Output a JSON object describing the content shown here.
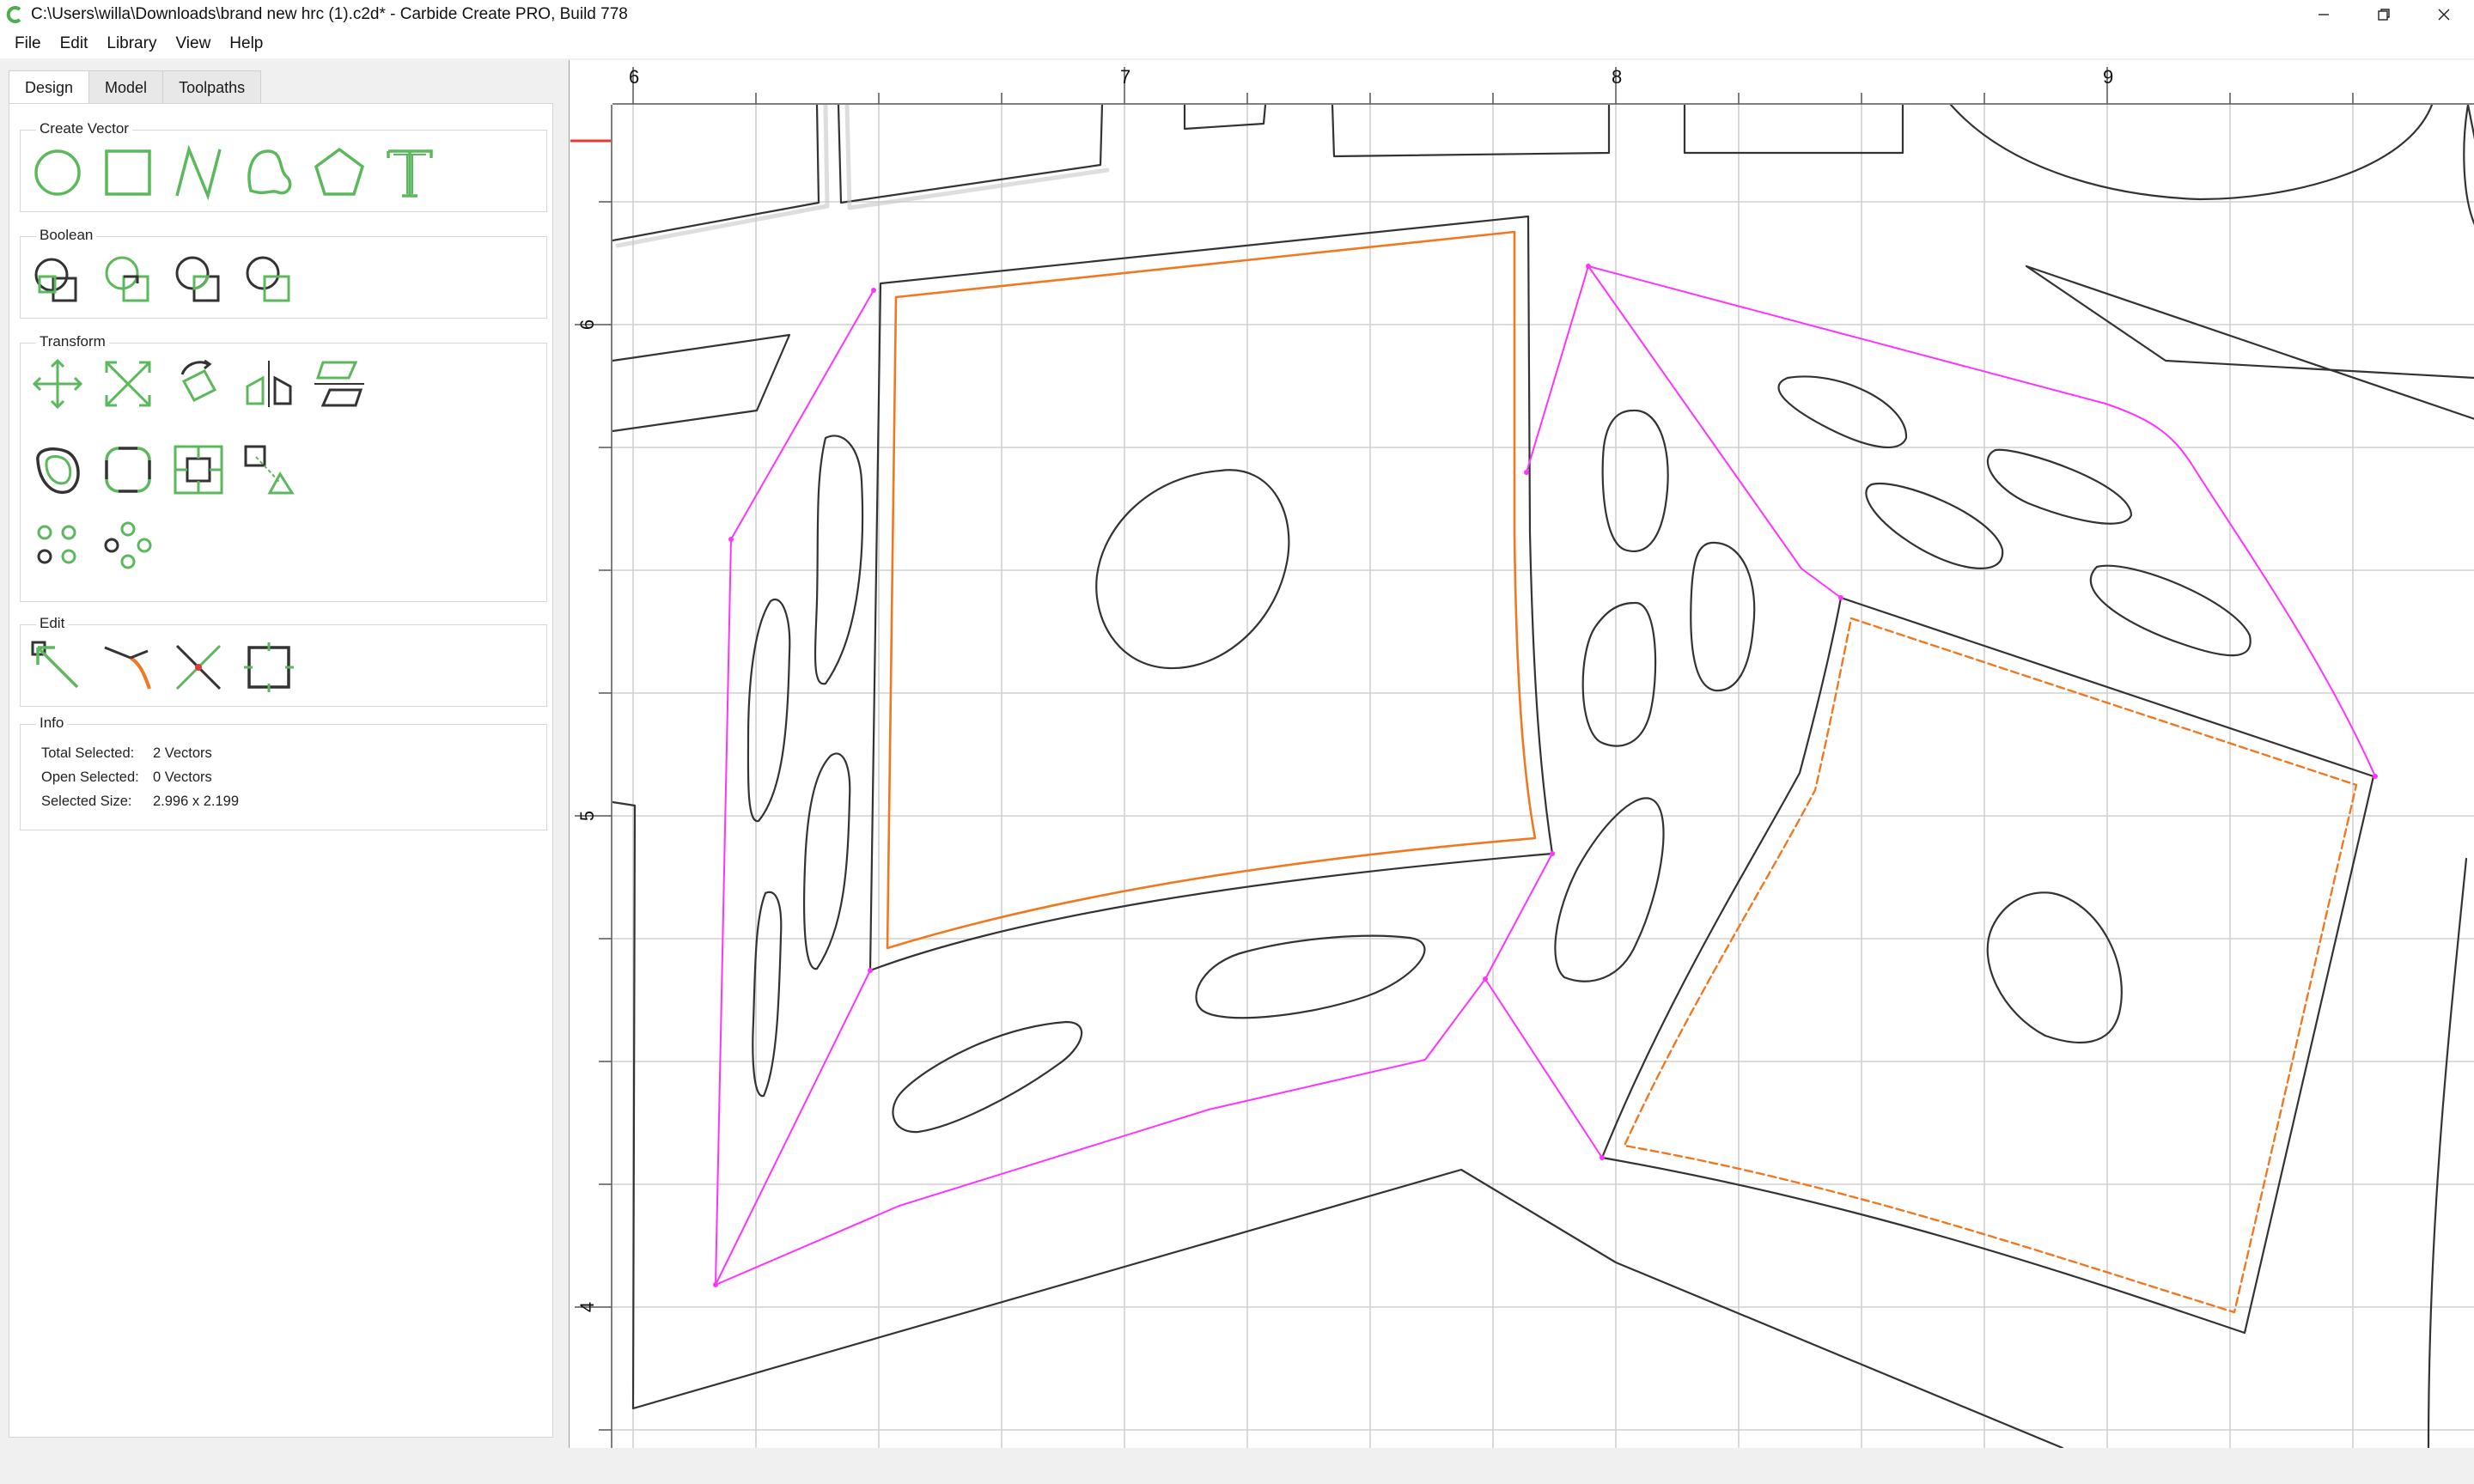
{
  "window": {
    "title": "C:\\Users\\willa\\Downloads\\brand new hrc (1).c2d* - Carbide Create PRO, Build 778",
    "controls": [
      "minimize-icon",
      "restore-icon",
      "close-icon"
    ]
  },
  "menu": [
    "File",
    "Edit",
    "Library",
    "View",
    "Help"
  ],
  "tabs": [
    "Design",
    "Model",
    "Toolpaths"
  ],
  "active_tab": "Design",
  "groups": {
    "create_vector": "Create Vector",
    "boolean": "Boolean",
    "transform": "Transform",
    "edit": "Edit",
    "info": "Info"
  },
  "tools": {
    "create_vector": [
      "circle-icon",
      "rectangle-icon",
      "polyline-icon",
      "curve-icon",
      "polygon-icon",
      "text-icon"
    ],
    "boolean": [
      "union-icon",
      "subtract-icon",
      "intersect-icon",
      "merge-icon"
    ],
    "transform": [
      "move-icon",
      "scale-icon",
      "rotate-icon",
      "mirror-icon",
      "align-icon",
      "offset-icon",
      "fillet-icon",
      "center-icon",
      "snap-icon",
      "linear-array-icon",
      "circular-array-icon"
    ],
    "edit": [
      "node-edit-icon",
      "trim-icon",
      "cut-icon",
      "bounding-box-icon"
    ]
  },
  "info": {
    "total_selected_label": "Total Selected:",
    "total_selected_value": "2 Vectors",
    "open_selected_label": "Open Selected:",
    "open_selected_value": "0 Vectors",
    "selected_size_label": "Selected Size:",
    "selected_size_value": "2.996 x 2.199"
  },
  "rulers": {
    "top_labels": [
      "6",
      "7",
      "8",
      "9"
    ],
    "left_labels": [
      "6",
      "5",
      "4"
    ]
  },
  "colors": {
    "accent_green": "#5cb85c",
    "selection_orange": "#f07820",
    "construction_magenta": "#ff33ff",
    "vector_line": "#333333",
    "grid": "#d0d0d0"
  }
}
